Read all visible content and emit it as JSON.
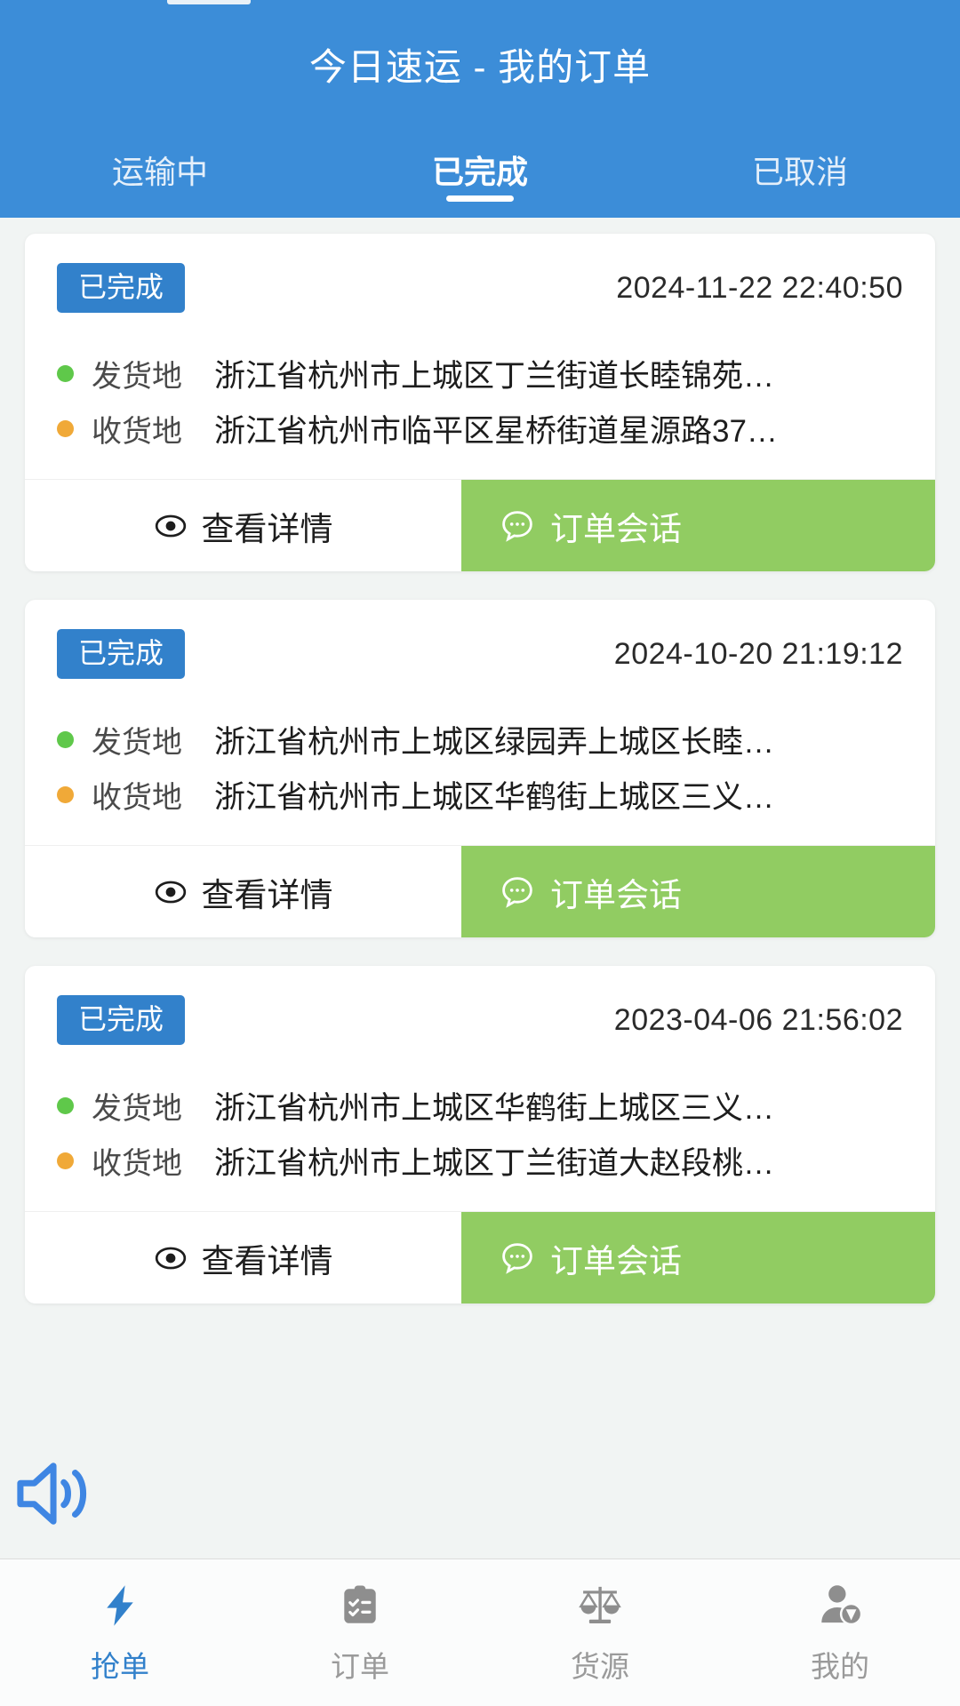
{
  "app": {
    "title": "今日速运 - 我的订单",
    "accent_color": "#3c8dd8",
    "chat_button_color": "#91cc62",
    "badge_color": "#3281cb",
    "origin_dot_color": "#5fc84a",
    "dest_dot_color": "#f0a938"
  },
  "tabs": [
    {
      "label": "运输中",
      "active": false
    },
    {
      "label": "已完成",
      "active": true
    },
    {
      "label": "已取消",
      "active": false
    }
  ],
  "labels": {
    "origin": "发货地",
    "destination": "收货地",
    "view_detail": "查看详情",
    "order_chat": "订单会话"
  },
  "orders": [
    {
      "status": "已完成",
      "time": "2024-11-22 22:40:50",
      "origin": "浙江省杭州市上城区丁兰街道长睦锦苑…",
      "destination": "浙江省杭州市临平区星桥街道星源路37…"
    },
    {
      "status": "已完成",
      "time": "2024-10-20 21:19:12",
      "origin": "浙江省杭州市上城区绿园弄上城区长睦…",
      "destination": "浙江省杭州市上城区华鹤街上城区三义…"
    },
    {
      "status": "已完成",
      "time": "2023-04-06 21:56:02",
      "origin": "浙江省杭州市上城区华鹤街上城区三义…",
      "destination": "浙江省杭州市上城区丁兰街道大赵段桃…"
    }
  ],
  "floating": {
    "speaker_icon": "speaker-volume-icon",
    "speaker_color": "#3f86e3"
  },
  "bottom_nav": [
    {
      "label": "抢单",
      "icon": "lightning-bolt-icon",
      "active": true
    },
    {
      "label": "订单",
      "icon": "clipboard-checklist-icon",
      "active": false
    },
    {
      "label": "货源",
      "icon": "balance-scale-icon",
      "active": false
    },
    {
      "label": "我的",
      "icon": "user-verified-icon",
      "active": false
    }
  ]
}
